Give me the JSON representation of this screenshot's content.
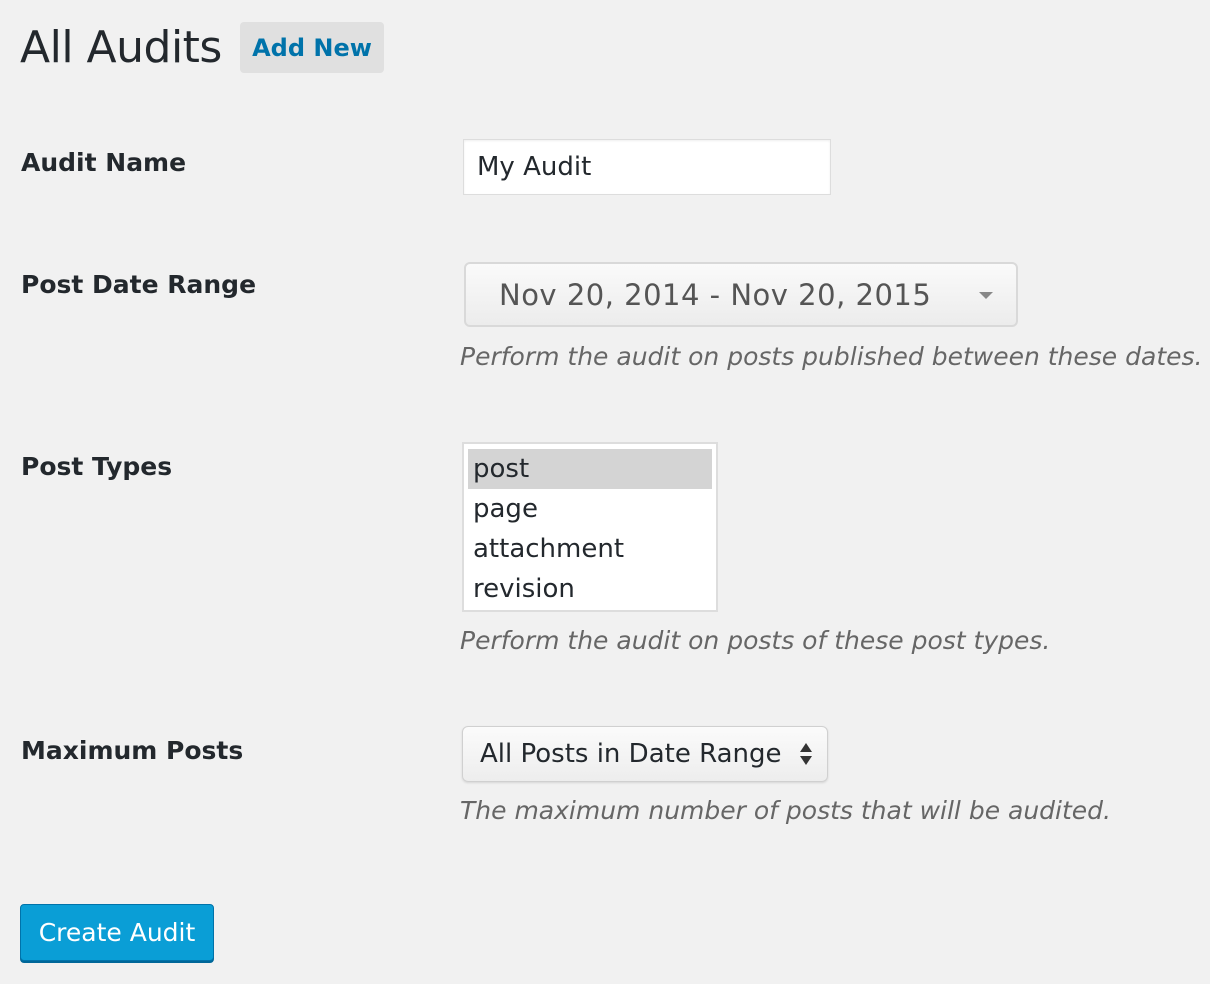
{
  "header": {
    "title": "All Audits",
    "add_new_label": "Add New"
  },
  "form": {
    "audit_name": {
      "label": "Audit Name",
      "value": "My Audit"
    },
    "post_date_range": {
      "label": "Post Date Range",
      "value": "Nov 20, 2014 - Nov 20, 2015",
      "description": "Perform the audit on posts published between these dates."
    },
    "post_types": {
      "label": "Post Types",
      "options": [
        "post",
        "page",
        "attachment",
        "revision"
      ],
      "selected": "post",
      "description": "Perform the audit on posts of these post types."
    },
    "maximum_posts": {
      "label": "Maximum Posts",
      "selected": "All Posts in Date Range",
      "description": "The maximum number of posts that will be audited."
    },
    "submit_label": "Create Audit"
  },
  "colors": {
    "background": "#f1f1f1",
    "link": "#0073aa",
    "primary_button": "#0a9ed6",
    "selected_option": "#d4d4d4"
  }
}
